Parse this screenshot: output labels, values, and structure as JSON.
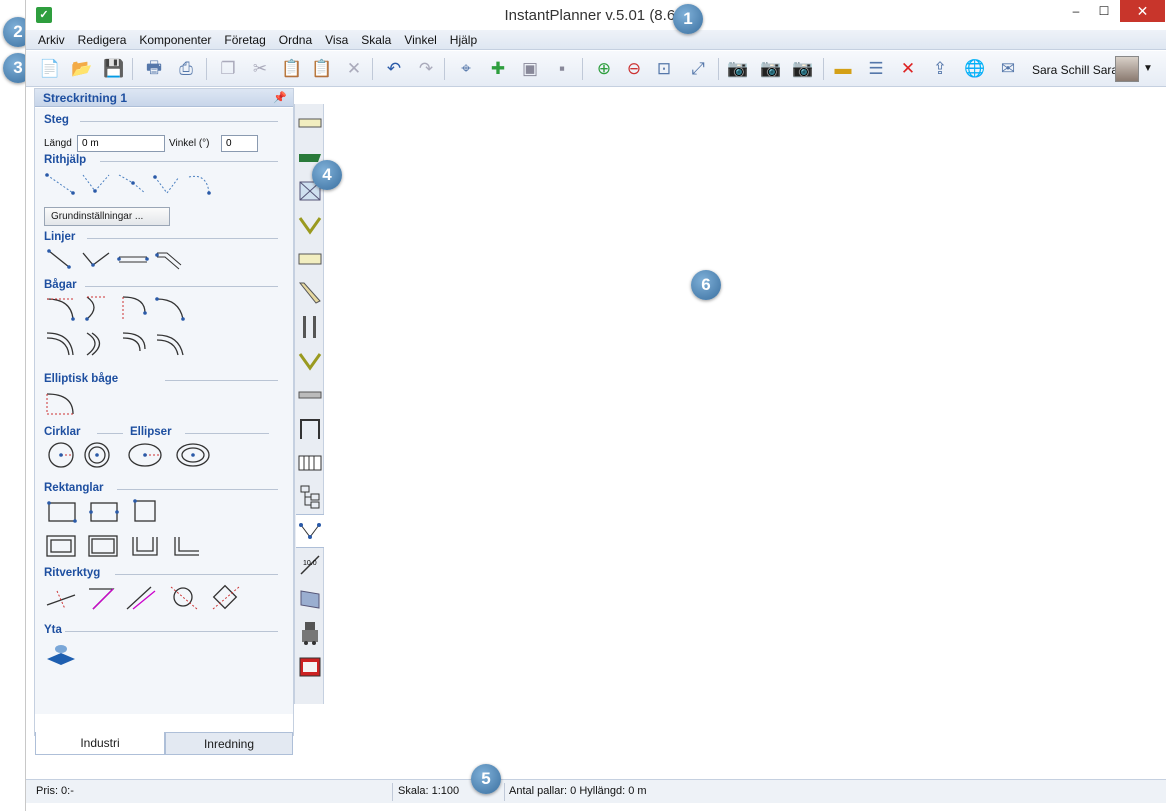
{
  "window": {
    "title": "InstantPlanner v.5.01 (8.61)",
    "min": "–",
    "max": "☐",
    "close": "✕"
  },
  "menu": [
    "Arkiv",
    "Redigera",
    "Komponenter",
    "Företag",
    "Ordna",
    "Visa",
    "Skala",
    "Vinkel",
    "Hjälp"
  ],
  "toolbar": {
    "user_name": "Sara Schill Saran"
  },
  "panel": {
    "title": "Streckritning 1",
    "sections": {
      "steg": "Steg",
      "rithjalp": "Rithjälp",
      "linjer": "Linjer",
      "bagar": "Bågar",
      "elliptisk": "Elliptisk båge",
      "cirklar": "Cirklar",
      "ellipser": "Ellipser",
      "rektanglar": "Rektanglar",
      "ritverktyg": "Ritverktyg",
      "yta": "Yta"
    },
    "langd_label": "Längd",
    "langd_value": "0 m",
    "vinkel_label": "Vinkel (°)",
    "vinkel_value": "0",
    "grund_button": "Grundinställningar ...",
    "tabs": [
      "Industri",
      "Inredning"
    ]
  },
  "status": {
    "pris": "Pris: 0:-",
    "skala": "Skala: 1:100",
    "antal": "Antal pallar: 0 Hyllängd: 0 m"
  },
  "badges": [
    "1",
    "2",
    "3",
    "4",
    "5",
    "6"
  ],
  "colors": {
    "accent": "#1e4fa0",
    "badge": "#3a6f9f",
    "close": "#c8352b"
  }
}
